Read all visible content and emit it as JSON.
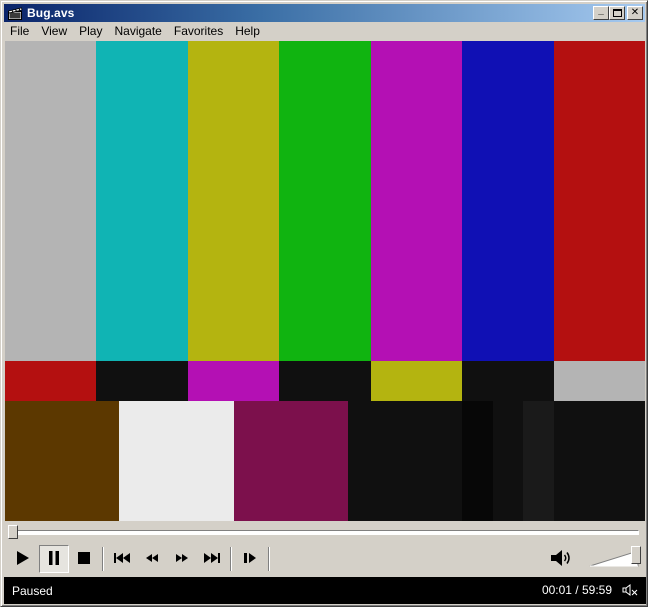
{
  "window": {
    "title": "Bug.avs",
    "minimize_glyph": "_",
    "maximize_glyph": "□",
    "close_glyph": "✕"
  },
  "menu": [
    "File",
    "View",
    "Play",
    "Navigate",
    "Favorites",
    "Help"
  ],
  "video": {
    "row1": [
      "#b4b4b4",
      "#10b4b4",
      "#b4b410",
      "#10b410",
      "#b410b4",
      "#1010b4",
      "#b41010"
    ],
    "row2": [
      "#b41010",
      "#101010",
      "#b410b4",
      "#101010",
      "#b4b410",
      "#101010",
      "#b4b4b4"
    ],
    "row3": [
      {
        "color": "#5c3800",
        "fraction": 0.1786
      },
      {
        "color": "#ebebeb",
        "fraction": 0.1786
      },
      {
        "color": "#7c104c",
        "fraction": 0.1786
      },
      {
        "color": "#101010",
        "fraction": 0.1786
      },
      {
        "color": "#070707",
        "fraction": 0.0476
      },
      {
        "color": "#101010",
        "fraction": 0.0476
      },
      {
        "color": "#1a1a1a",
        "fraction": 0.0476
      },
      {
        "color": "#101010",
        "fraction": 0.1428
      }
    ]
  },
  "seek": {
    "progress": 0.0003
  },
  "controls": {
    "buttons": [
      {
        "name": "play-button",
        "icon": "play-icon",
        "pressed": false
      },
      {
        "name": "pause-button",
        "icon": "pause-icon",
        "pressed": true
      },
      {
        "name": "stop-button",
        "icon": "stop-icon",
        "pressed": false
      },
      {
        "name": "previous-button",
        "icon": "skip-back-icon",
        "pressed": false
      },
      {
        "name": "rewind-button",
        "icon": "rewind-icon",
        "pressed": false
      },
      {
        "name": "fast-forward-button",
        "icon": "fast-forward-icon",
        "pressed": false
      },
      {
        "name": "next-button",
        "icon": "skip-forward-icon",
        "pressed": false
      },
      {
        "name": "frame-step-button",
        "icon": "frame-step-icon",
        "pressed": false
      }
    ],
    "volume_level": 1.0
  },
  "status": {
    "state": "Paused",
    "time": "00:01 / 59:59"
  }
}
